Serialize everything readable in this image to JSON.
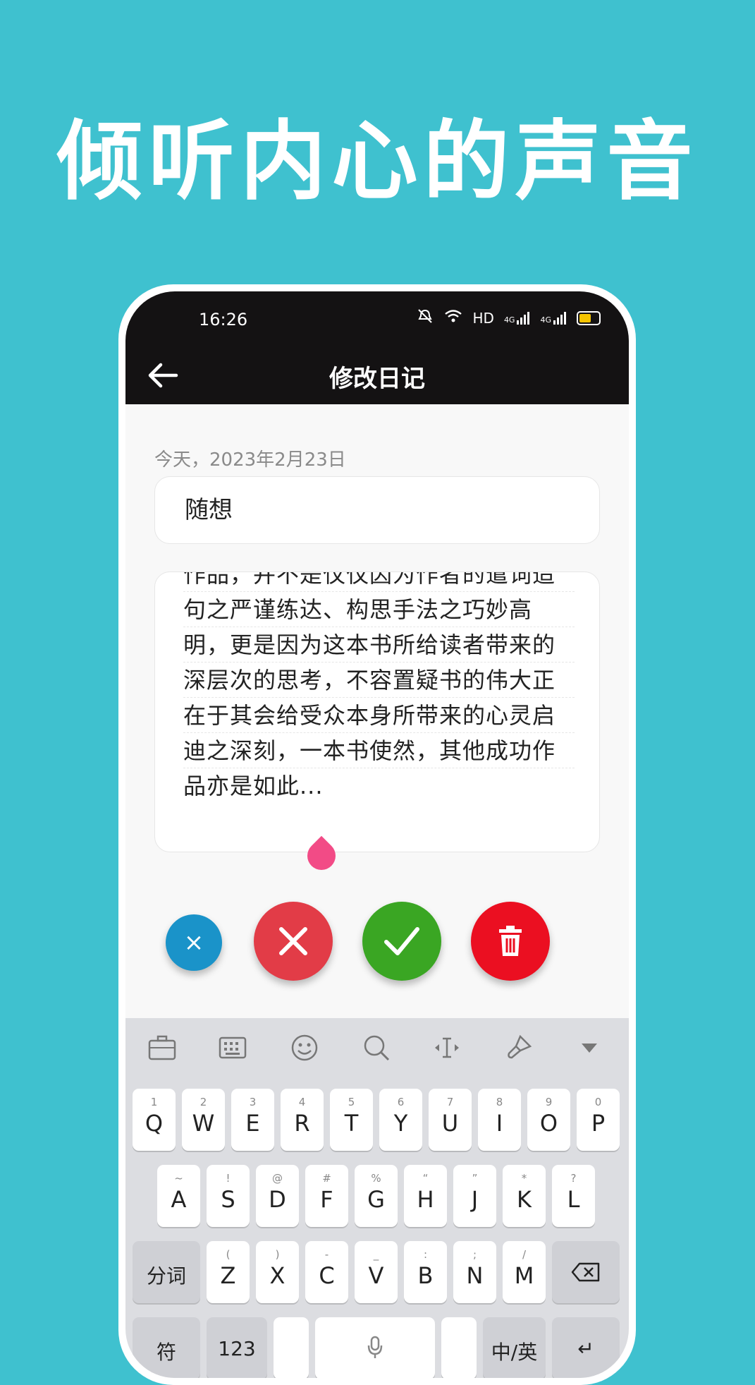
{
  "headline": "倾听内心的声音",
  "status": {
    "time": "16:26",
    "network": "HD",
    "signal1": "4G",
    "signal2": "4G"
  },
  "header": {
    "title": "修改日记"
  },
  "entry": {
    "date": "今天，2023年2月23日",
    "title_value": "随想",
    "body_lines": [
      "作品，并不是仅仅因为作者的遣词造",
      "句之严谨练达、构思手法之巧妙高",
      "明，更是因为这本书所给读者带来的",
      "深层次的思考，不容置疑书的伟大正",
      "在于其会给受众本身所带来的心灵启",
      "迪之深刻，一本书使然，其他成功作",
      "品亦是如此..."
    ]
  },
  "actions": {
    "clear_symbol": "×",
    "colors": {
      "clear": "#1a93c9",
      "cancel": "#e23c47",
      "confirm": "#3aa623",
      "delete": "#eb0f21"
    }
  },
  "keyboard": {
    "row1": [
      {
        "main": "Q",
        "sub": "1"
      },
      {
        "main": "W",
        "sub": "2"
      },
      {
        "main": "E",
        "sub": "3"
      },
      {
        "main": "R",
        "sub": "4"
      },
      {
        "main": "T",
        "sub": "5"
      },
      {
        "main": "Y",
        "sub": "6"
      },
      {
        "main": "U",
        "sub": "7"
      },
      {
        "main": "I",
        "sub": "8"
      },
      {
        "main": "O",
        "sub": "9"
      },
      {
        "main": "P",
        "sub": "0"
      }
    ],
    "row2": [
      {
        "main": "A",
        "sub": "~"
      },
      {
        "main": "S",
        "sub": "!"
      },
      {
        "main": "D",
        "sub": "@"
      },
      {
        "main": "F",
        "sub": "#"
      },
      {
        "main": "G",
        "sub": "%"
      },
      {
        "main": "H",
        "sub": "“"
      },
      {
        "main": "J",
        "sub": "”"
      },
      {
        "main": "K",
        "sub": "*"
      },
      {
        "main": "L",
        "sub": "?"
      }
    ],
    "row3": [
      {
        "main": "Z",
        "sub": "("
      },
      {
        "main": "X",
        "sub": ")"
      },
      {
        "main": "C",
        "sub": "-"
      },
      {
        "main": "V",
        "sub": "_"
      },
      {
        "main": "B",
        "sub": ":"
      },
      {
        "main": "N",
        "sub": ";"
      },
      {
        "main": "M",
        "sub": "/"
      }
    ],
    "segment_label": "分词",
    "symbol_label": "符",
    "numbers_label": "123",
    "lang_label": "中/英",
    "enter_symbol": "↵"
  }
}
